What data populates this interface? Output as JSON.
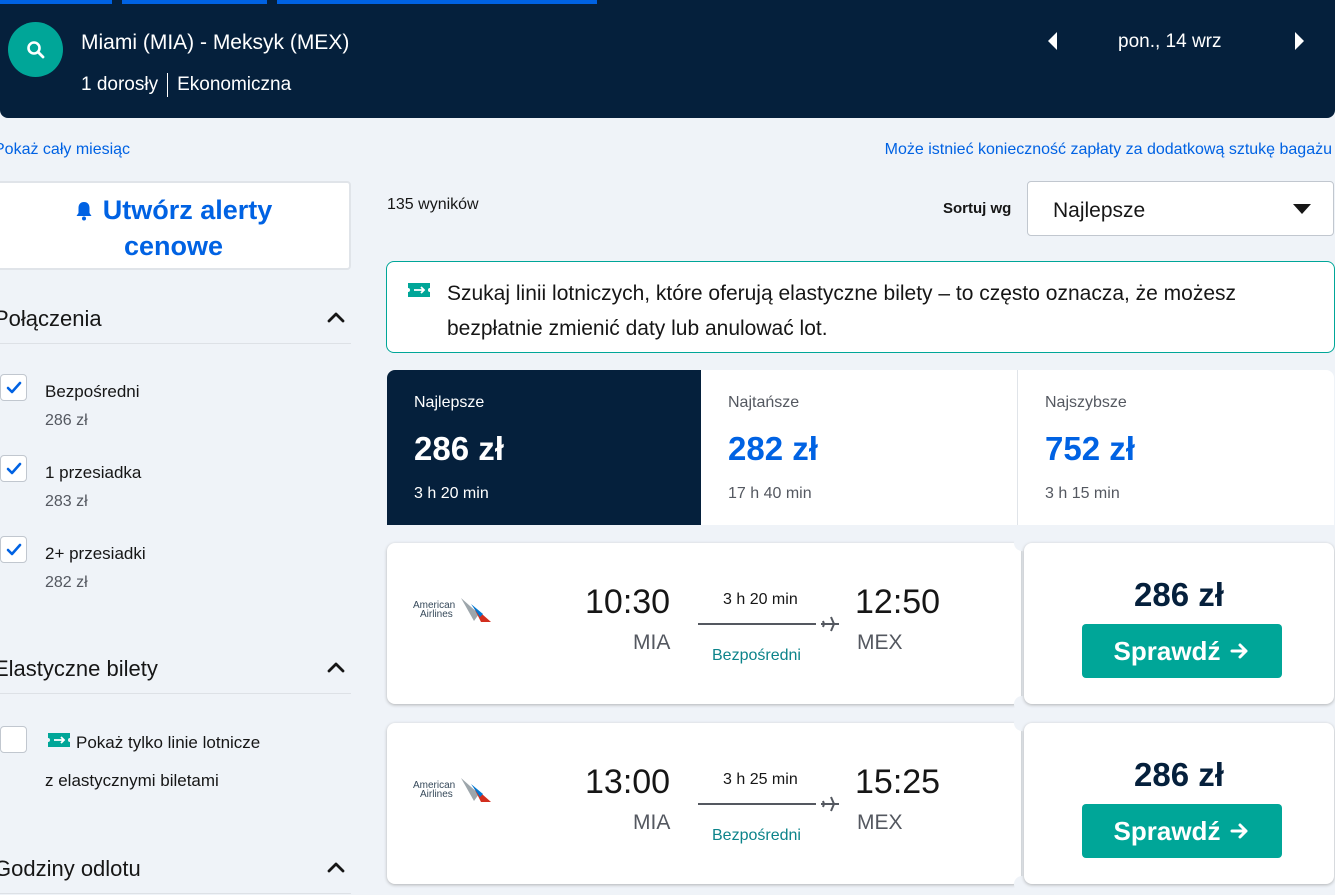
{
  "header": {
    "route": "Miami (MIA) - Meksyk (MEX)",
    "passengers": "1 dorosły",
    "cabin": "Ekonomiczna",
    "date": "pon., 14 wrz"
  },
  "links": {
    "whole_month": "Pokaż cały miesiąc",
    "baggage_notice": "Może istnieć konieczność zapłaty za dodatkową sztukę bagażu"
  },
  "sidebar": {
    "alert_line1": "Utwórz alerty",
    "alert_line2": "cenowe",
    "stops_title": "Połączenia",
    "stops": [
      {
        "label": "Bezpośredni",
        "price": "286 zł",
        "checked": true
      },
      {
        "label": "1 przesiadka",
        "price": "283 zł",
        "checked": true
      },
      {
        "label": "2+ przesiadki",
        "price": "282 zł",
        "checked": true
      }
    ],
    "flex_title": "Elastyczne bilety",
    "flex_label1": "Pokaż tylko linie lotnicze",
    "flex_label2": "z elastycznymi biletami",
    "times_title": "Godziny odlotu"
  },
  "results": {
    "count": "135 wyników",
    "sort_label": "Sortuj wg",
    "sort_value": "Najlepsze"
  },
  "info_text": "Szukaj linii lotniczych, które oferują elastyczne bilety – to często oznacza, że możesz bezpłatnie zmienić daty lub anulować lot.",
  "tabs": [
    {
      "label": "Najlepsze",
      "price": "286 zł",
      "duration": "3 h 20 min"
    },
    {
      "label": "Najtańsze",
      "price": "282 zł",
      "duration": "17 h 40 min"
    },
    {
      "label": "Najszybsze",
      "price": "752 zł",
      "duration": "3 h 15 min"
    }
  ],
  "flights": [
    {
      "airline_line1": "American",
      "airline_line2": "Airlines",
      "dep_time": "10:30",
      "dep_code": "MIA",
      "duration": "3 h 20 min",
      "stops": "Bezpośredni",
      "arr_time": "12:50",
      "arr_code": "MEX",
      "price": "286 zł",
      "button": "Sprawdź"
    },
    {
      "airline_line1": "American",
      "airline_line2": "Airlines",
      "dep_time": "13:00",
      "dep_code": "MIA",
      "duration": "3 h 25 min",
      "stops": "Bezpośredni",
      "arr_time": "15:25",
      "arr_code": "MEX",
      "price": "286 zł",
      "button": "Sprawdź"
    }
  ],
  "colors": {
    "navy": "#05203c",
    "blue": "#0062e3",
    "teal": "#00a698"
  }
}
